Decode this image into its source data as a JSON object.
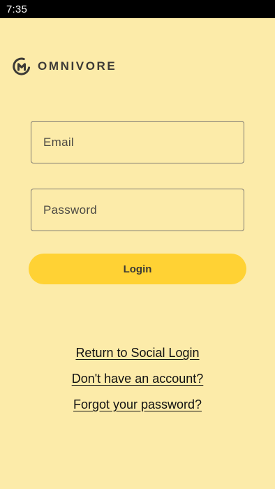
{
  "status_bar": {
    "time": "7:35"
  },
  "brand": {
    "name": "OMNIVORE",
    "icon": "omnivore-logo-icon"
  },
  "form": {
    "email_placeholder": "Email",
    "email_value": "",
    "password_placeholder": "Password",
    "password_value": "",
    "login_label": "Login"
  },
  "links": {
    "social_login": "Return to Social Login",
    "no_account": "Don't have an account?",
    "forgot_password": "Forgot your password?"
  },
  "colors": {
    "background": "#FCEBA9",
    "accent": "#FFD234",
    "text_dark": "#3C3A36"
  }
}
